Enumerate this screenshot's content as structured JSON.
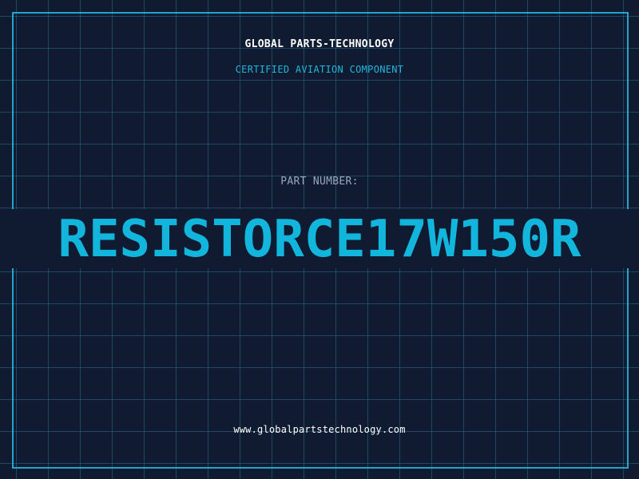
{
  "header": {
    "company": "GLOBAL PARTS-TECHNOLOGY",
    "subtitle": "CERTIFIED AVIATION COMPONENT"
  },
  "part": {
    "label": "PART NUMBER:",
    "number": "RESISTORCE17W150R"
  },
  "footer": {
    "website": "www.globalpartstechnology.com"
  },
  "colors": {
    "background": "#101a30",
    "grid": "#286e8c",
    "accent": "#12b6dc",
    "frame": "#1fa6c8",
    "label": "#9aa8bc",
    "text": "#ffffff"
  }
}
